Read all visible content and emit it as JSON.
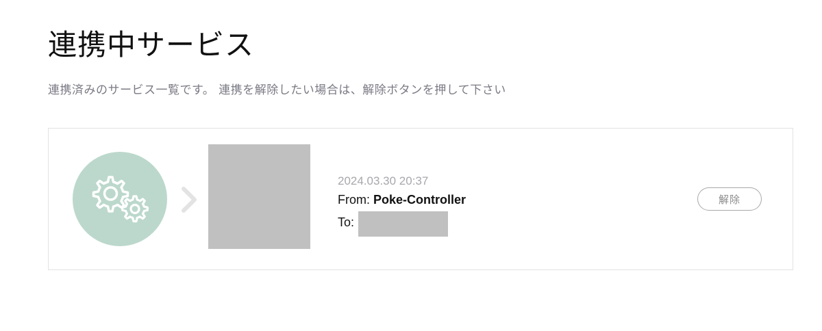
{
  "page": {
    "title": "連携中サービス",
    "description": "連携済みのサービス一覧です。 連携を解除したい場合は、解除ボタンを押して下さい"
  },
  "connections": [
    {
      "service_icon": "gears-icon",
      "timestamp": "2024.03.30 20:37",
      "from_label": "From:",
      "from_value": "Poke-Controller",
      "to_label": "To:",
      "release_label": "解除"
    }
  ],
  "colors": {
    "icon_circle": "#bcd8cc",
    "redacted": "#c0c0c0",
    "muted_text": "#7a7a84"
  }
}
